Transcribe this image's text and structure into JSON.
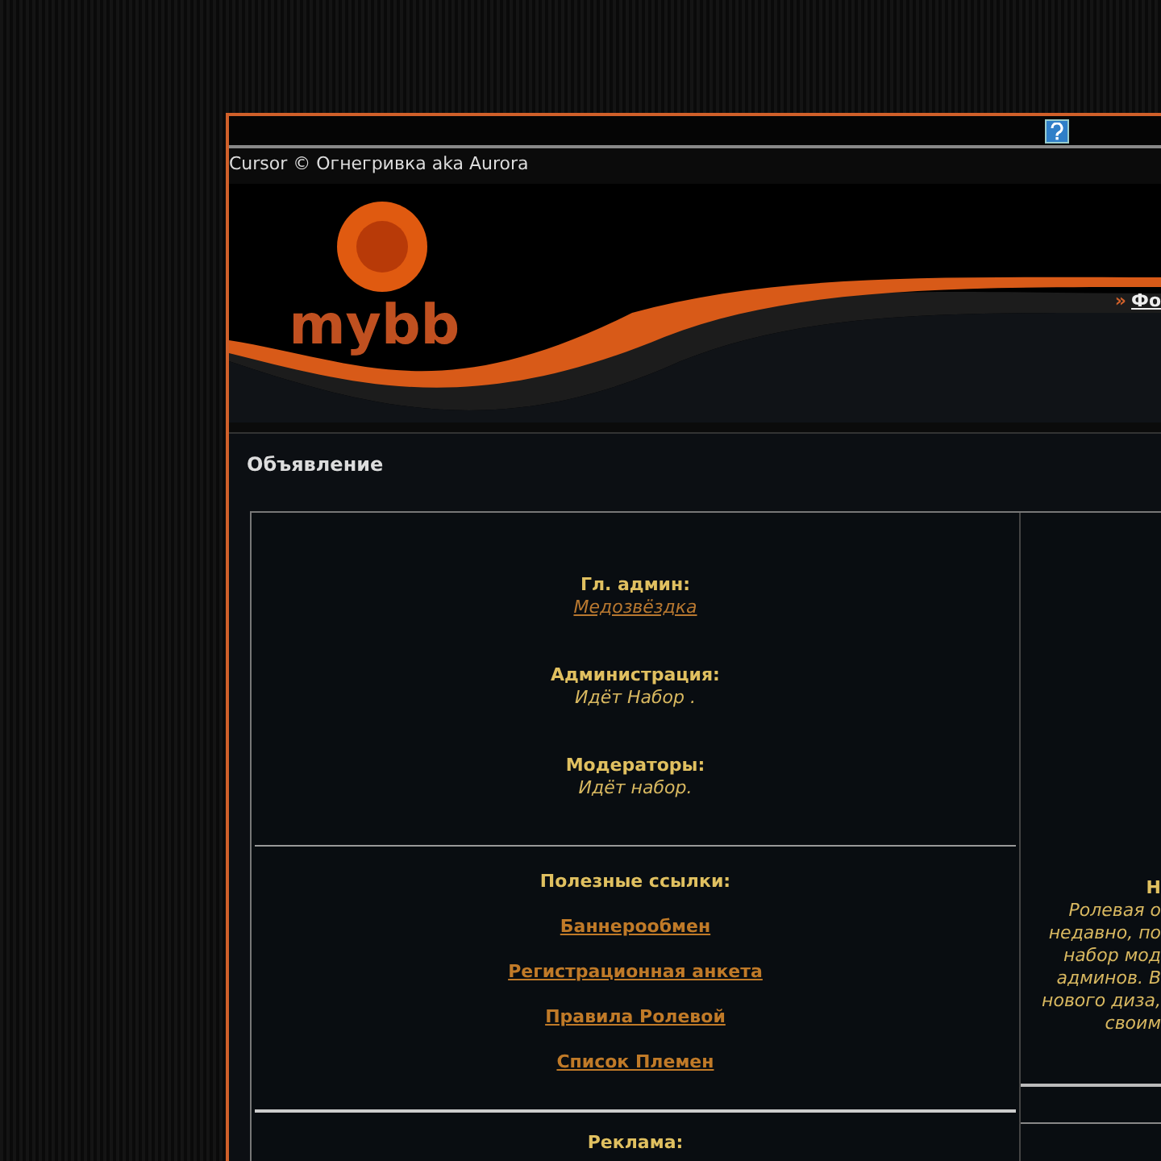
{
  "credit": "Cursor © Огнегривка aka Aurora",
  "header": {
    "logo_text": "mybb",
    "nav_marker": "»",
    "nav_link": "Фо"
  },
  "announcement": {
    "title": "Объявление",
    "staff": [
      {
        "role": "Гл. админ:",
        "value": "Медозвёздка",
        "kind": "link"
      },
      {
        "role": "Администрация:",
        "value": "Идёт Набор .",
        "kind": "text"
      },
      {
        "role": "Модераторы:",
        "value": "Идёт набор.",
        "kind": "text"
      }
    ],
    "links_title": "Полезные ссылки:",
    "links": [
      "Баннерообмен",
      "Регистрационная анкета",
      "Правила Ролевой",
      "Список Племен"
    ],
    "ads_title": "Реклама:",
    "news": {
      "title": "Н",
      "lines": [
        "Ролевая о",
        "недавно, по",
        "набор мод",
        "админов. В",
        "нового диза,",
        "своим"
      ]
    }
  }
}
